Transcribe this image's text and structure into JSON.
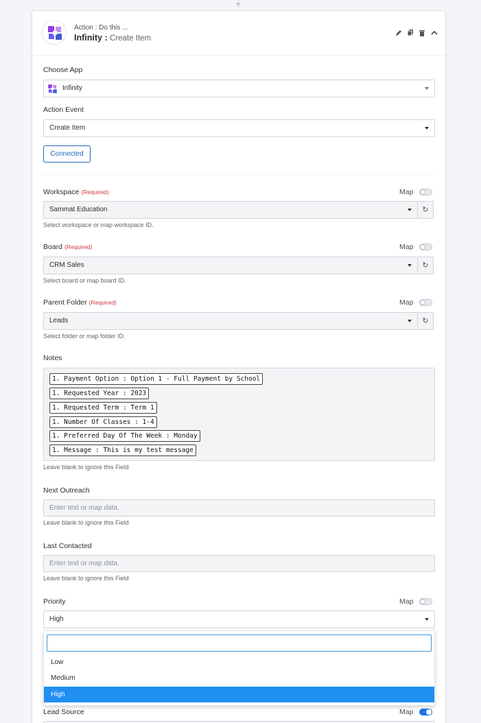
{
  "header": {
    "subtitle": "Action : Do this ...",
    "app_name": "Infinity :",
    "event_name": "Create Item"
  },
  "choose_app": {
    "label": "Choose App",
    "value": "Infinity"
  },
  "action_event": {
    "label": "Action Event",
    "value": "Create Item"
  },
  "connected_button": "Connected",
  "map_label": "Map",
  "required_label": "(Required)",
  "workspace": {
    "label": "Workspace",
    "value": "Sammat Education",
    "hint": "Select workspace or map workspace ID.",
    "map_on": false
  },
  "board": {
    "label": "Board",
    "value": "CRM Sales",
    "hint": "Select board or map board ID.",
    "map_on": false
  },
  "parent_folder": {
    "label": "Parent Folder",
    "value": "Leads",
    "hint": "Select folder or map folder ID.",
    "map_on": false
  },
  "notes": {
    "label": "Notes",
    "chips": [
      "1. Payment Option : Option 1 - Full Payment by School",
      "1. Requested Year : 2023",
      "1. Requested Term : Term 1",
      "1. Number Of Classes : 1-4",
      "1. Preferred Day Of The Week : Monday",
      "1. Message : This is my test message"
    ],
    "hint": "Leave blank to ignore this Field"
  },
  "next_outreach": {
    "label": "Next Outreach",
    "placeholder": "Enter text or map data.",
    "hint": "Leave blank to ignore this Field"
  },
  "last_contacted": {
    "label": "Last Contacted",
    "placeholder": "Enter text or map data.",
    "hint": "Leave blank to ignore this Field"
  },
  "priority": {
    "label": "Priority",
    "value": "High",
    "map_on": false,
    "search_value": "",
    "options": [
      "Low",
      "Medium",
      "High"
    ],
    "selected_option": "High"
  },
  "lead_source": {
    "label": "Lead Source",
    "map_on": true
  },
  "colors": {
    "accent": "#1f8ff2",
    "required": "#d0343c",
    "toggle_on": "#1a73e8"
  },
  "icons": [
    "infinity-logo-icon",
    "edit-icon",
    "copy-icon",
    "trash-icon",
    "chevron-up-icon",
    "caret-down-icon",
    "refresh-icon",
    "arrow-down-icon"
  ]
}
